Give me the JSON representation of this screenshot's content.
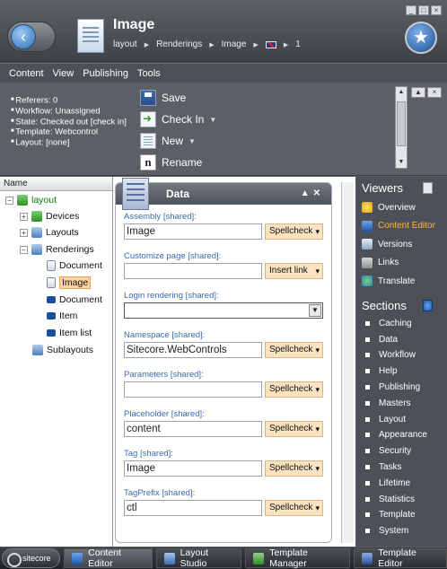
{
  "window": {
    "title": "Image",
    "breadcrumb": [
      "layout",
      "Renderings",
      "Image",
      "1"
    ],
    "controls": [
      "_",
      "□",
      "×"
    ]
  },
  "menu": [
    "Content",
    "View",
    "Publishing",
    "Tools"
  ],
  "item_info": [
    "Referers: 0",
    "Workflow: Unassigned",
    "State: Checked out [check in]",
    "Template: Webcontrol",
    "Layout: [none]"
  ],
  "ribbon": {
    "save": "Save",
    "check_in": "Check In",
    "new": "New",
    "rename": "Rename"
  },
  "tree": {
    "header": "Name",
    "nodes": [
      {
        "label": "layout",
        "level": 0,
        "expander": "-",
        "icon": "green-sheet-icon"
      },
      {
        "label": "Devices",
        "level": 1,
        "expander": "+",
        "icon": "device-icon"
      },
      {
        "label": "Layouts",
        "level": 1,
        "expander": "+",
        "icon": "layout-folder-icon"
      },
      {
        "label": "Renderings",
        "level": 1,
        "expander": "-",
        "icon": "renderings-folder-icon"
      },
      {
        "label": "Document",
        "level": 2,
        "icon": "document-icon"
      },
      {
        "label": "Image",
        "level": 2,
        "icon": "document-icon",
        "selected": true
      },
      {
        "label": "Document",
        "level": 2,
        "icon": "control-icon"
      },
      {
        "label": "Item",
        "level": 2,
        "icon": "control-icon"
      },
      {
        "label": "Item list",
        "level": 2,
        "icon": "control-icon"
      },
      {
        "label": "Sublayouts",
        "level": 1,
        "icon": "sublayout-icon"
      }
    ]
  },
  "data_panel": {
    "title": "Data",
    "fields": [
      {
        "label": "Assembly [shared]:",
        "value": "Image",
        "button": "Spellcheck"
      },
      {
        "label": "Customize page [shared]:",
        "value": "",
        "button": "Insert link"
      },
      {
        "label": "Login rendering [shared]:",
        "value": "",
        "type": "select"
      },
      {
        "label": "Namespace [shared]:",
        "value": "Sitecore.WebControls",
        "button": "Spellcheck"
      },
      {
        "label": "Parameters [shared]:",
        "value": "",
        "button": "Spellcheck"
      },
      {
        "label": "Placeholder [shared]:",
        "value": "content",
        "button": "Spellcheck"
      },
      {
        "label": "Tag [shared]:",
        "value": "Image",
        "button": "Spellcheck"
      },
      {
        "label": "TagPrefix [shared]:",
        "value": "ctl",
        "button": "Spellcheck"
      }
    ]
  },
  "viewers": {
    "title": "Viewers",
    "items": [
      {
        "label": "Overview",
        "icon": "overview-icon"
      },
      {
        "label": "Content Editor",
        "icon": "content-editor-icon",
        "active": true
      },
      {
        "label": "Versions",
        "icon": "versions-icon"
      },
      {
        "label": "Links",
        "icon": "links-icon"
      },
      {
        "label": "Translate",
        "icon": "translate-icon"
      }
    ]
  },
  "sections": {
    "title": "Sections",
    "items": [
      "Caching",
      "Data",
      "Workflow",
      "Help",
      "Publishing",
      "Masters",
      "Layout",
      "Appearance",
      "Security",
      "Tasks",
      "Lifetime",
      "Statistics",
      "Template",
      "System"
    ]
  },
  "taskbar": {
    "logo": "sitecore",
    "tasks": [
      {
        "label": "Content Editor",
        "active": true
      },
      {
        "label": "Layout Studio"
      },
      {
        "label": "Template Manager"
      },
      {
        "label": "Template Editor"
      }
    ]
  },
  "colors": {
    "accent_orange": "#ffb348",
    "label_blue": "#3a6ab5",
    "button_peach": "#fbe3c1",
    "selection": "#ffd3a0"
  }
}
